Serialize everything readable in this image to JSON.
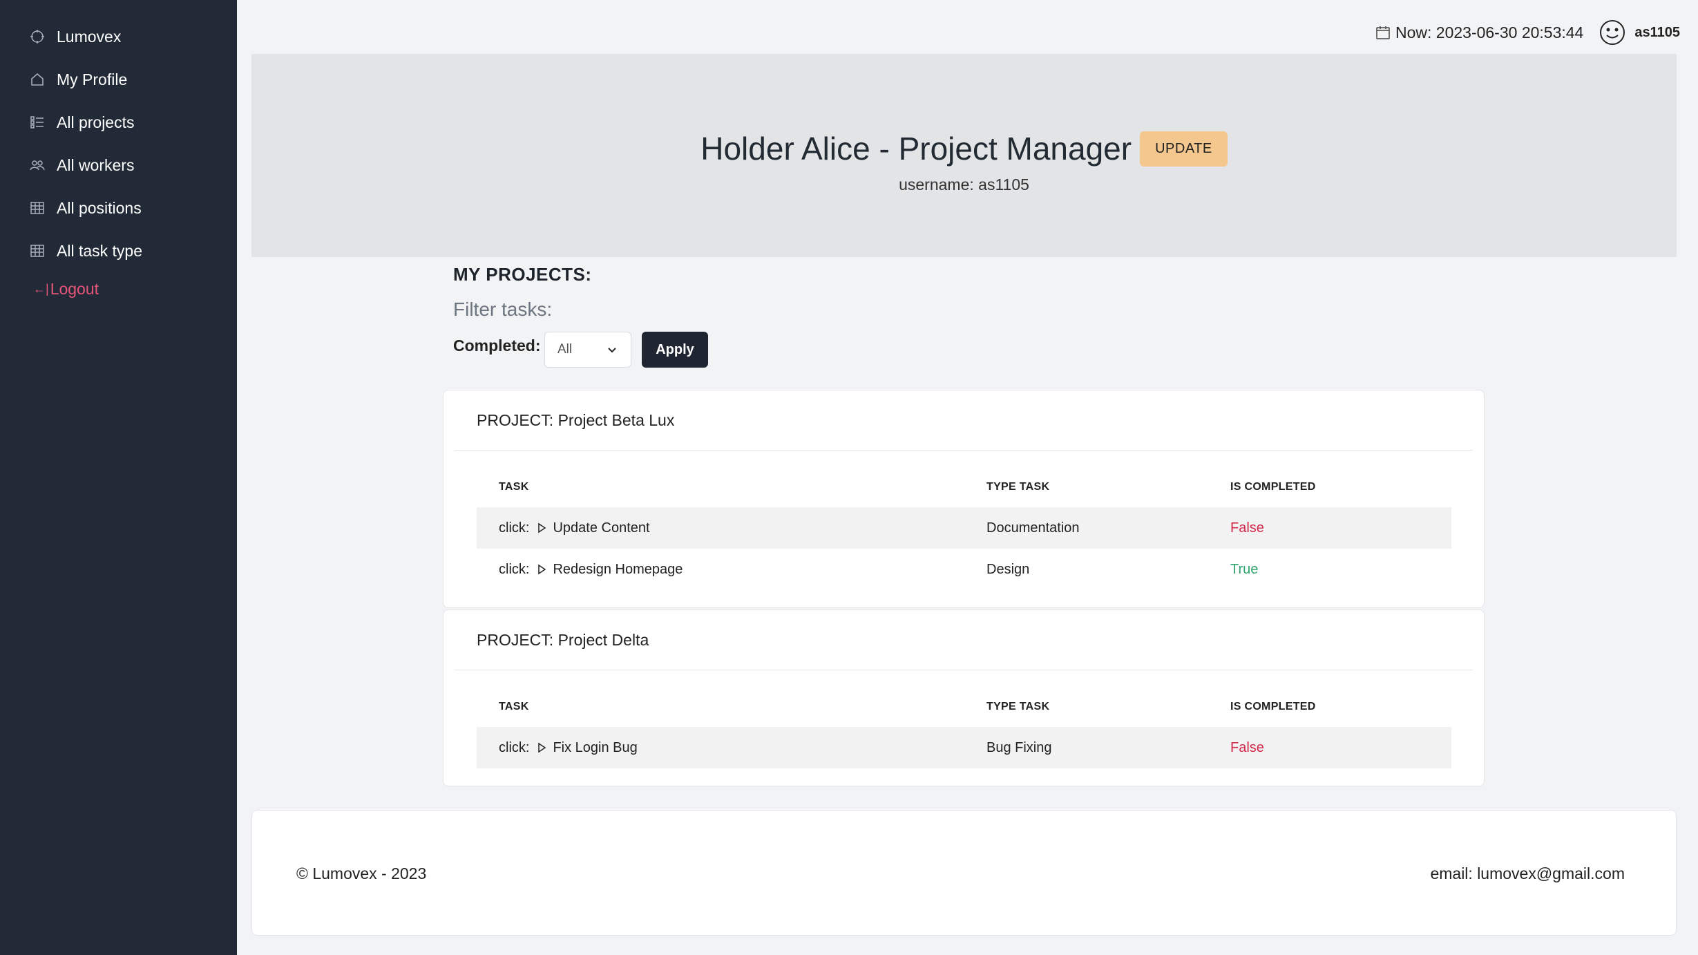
{
  "sidebar": {
    "brand": {
      "label": "Lumovex",
      "icon": "crosshair-icon"
    },
    "items": [
      {
        "label": "My Profile",
        "icon": "home-icon"
      },
      {
        "label": "All projects",
        "icon": "list-icon"
      },
      {
        "label": "All workers",
        "icon": "users-icon"
      },
      {
        "label": "All positions",
        "icon": "table-icon"
      },
      {
        "label": "All task type",
        "icon": "table-icon"
      }
    ],
    "logout": {
      "label": "Logout",
      "icon": "logout-arrow-icon",
      "color": "#e8557a"
    }
  },
  "topbar": {
    "datetime": "Now: 2023-06-30 20:53:44",
    "username": "as1105"
  },
  "hero": {
    "title": "Holder Alice - Project Manager",
    "update_label": "UPDATE",
    "subtitle": "username: as1105"
  },
  "filters": {
    "section_title": "MY PROJECTS:",
    "filter_title": "Filter tasks:",
    "completed_label": "Completed:",
    "completed_value": "All",
    "apply_label": "Apply"
  },
  "table_headers": {
    "task": "TASK",
    "type": "TYPE TASK",
    "completed": "IS COMPLETED"
  },
  "projects": [
    {
      "title": "PROJECT: Project Beta Lux",
      "tasks": [
        {
          "prefix": "click:",
          "name": "Update Content",
          "type": "Documentation",
          "completed": "False"
        },
        {
          "prefix": "click:",
          "name": "Redesign Homepage",
          "type": "Design",
          "completed": "True"
        }
      ]
    },
    {
      "title": "PROJECT: Project Delta",
      "tasks": [
        {
          "prefix": "click:",
          "name": "Fix Login Bug",
          "type": "Bug Fixing",
          "completed": "False"
        }
      ]
    }
  ],
  "footer": {
    "copyright": "© Lumovex - 2023",
    "email": "email: lumovex@gmail.com"
  },
  "colors": {
    "sidebar_bg": "#212a36",
    "accent_update": "#f3c78d",
    "status_false": "#d22a4b",
    "status_true": "#2fa36b"
  }
}
